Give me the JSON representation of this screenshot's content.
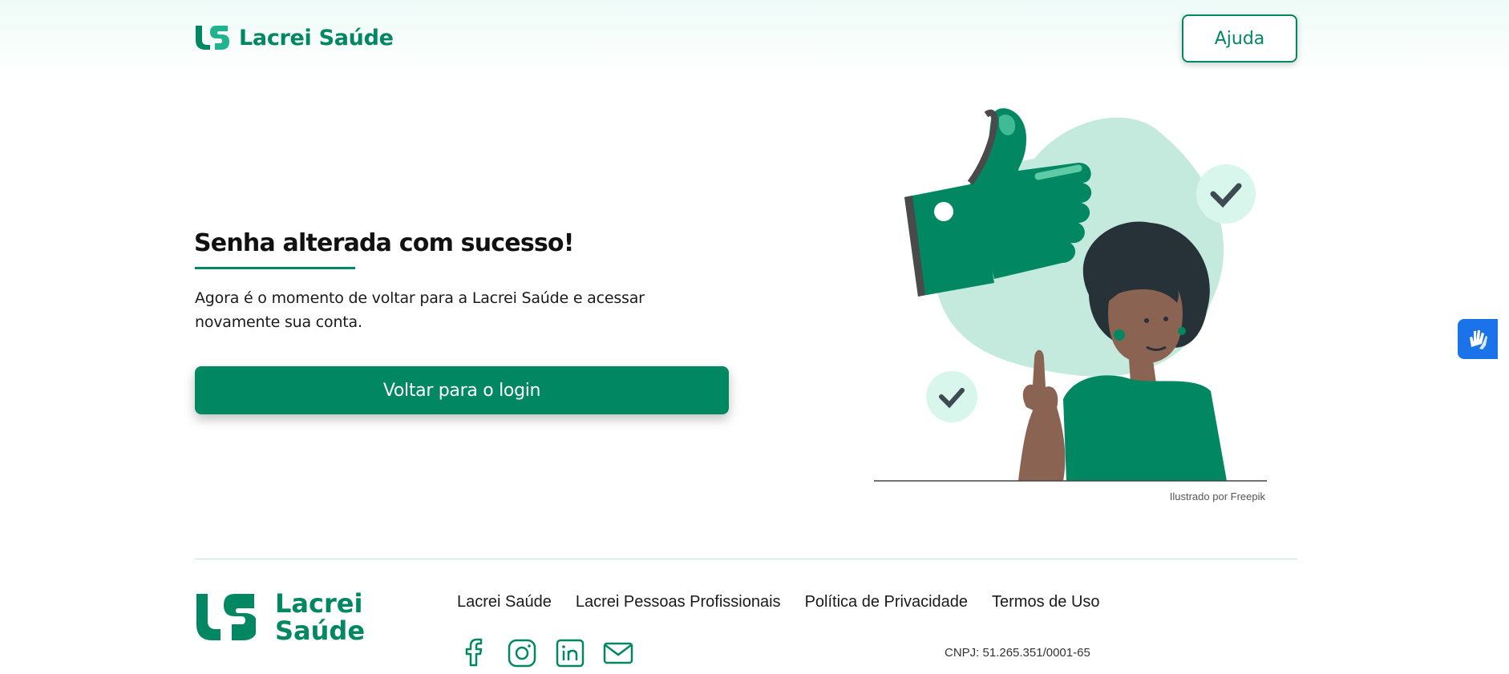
{
  "brand": {
    "name": "Lacrei Saúde",
    "footer_line1": "Lacrei",
    "footer_line2": "Saúde",
    "color": "#018762"
  },
  "header": {
    "help_label": "Ajuda"
  },
  "main": {
    "title": "Senha alterada com sucesso!",
    "description": "Agora é o momento de voltar para a Lacrei Saúde e acessar novamente sua conta.",
    "login_button": "Voltar para o login",
    "illustration_credit": "Ilustrado por Freepik"
  },
  "footer": {
    "links": [
      "Lacrei Saúde",
      "Lacrei Pessoas Profissionais",
      "Política de Privacidade",
      "Termos de Uso"
    ],
    "social_icons": [
      "facebook-icon",
      "instagram-icon",
      "linkedin-icon",
      "email-icon"
    ],
    "cnpj": "CNPJ: 51.265.351/0001-65"
  },
  "accessibility": {
    "icon": "sign-language-hands-icon"
  }
}
